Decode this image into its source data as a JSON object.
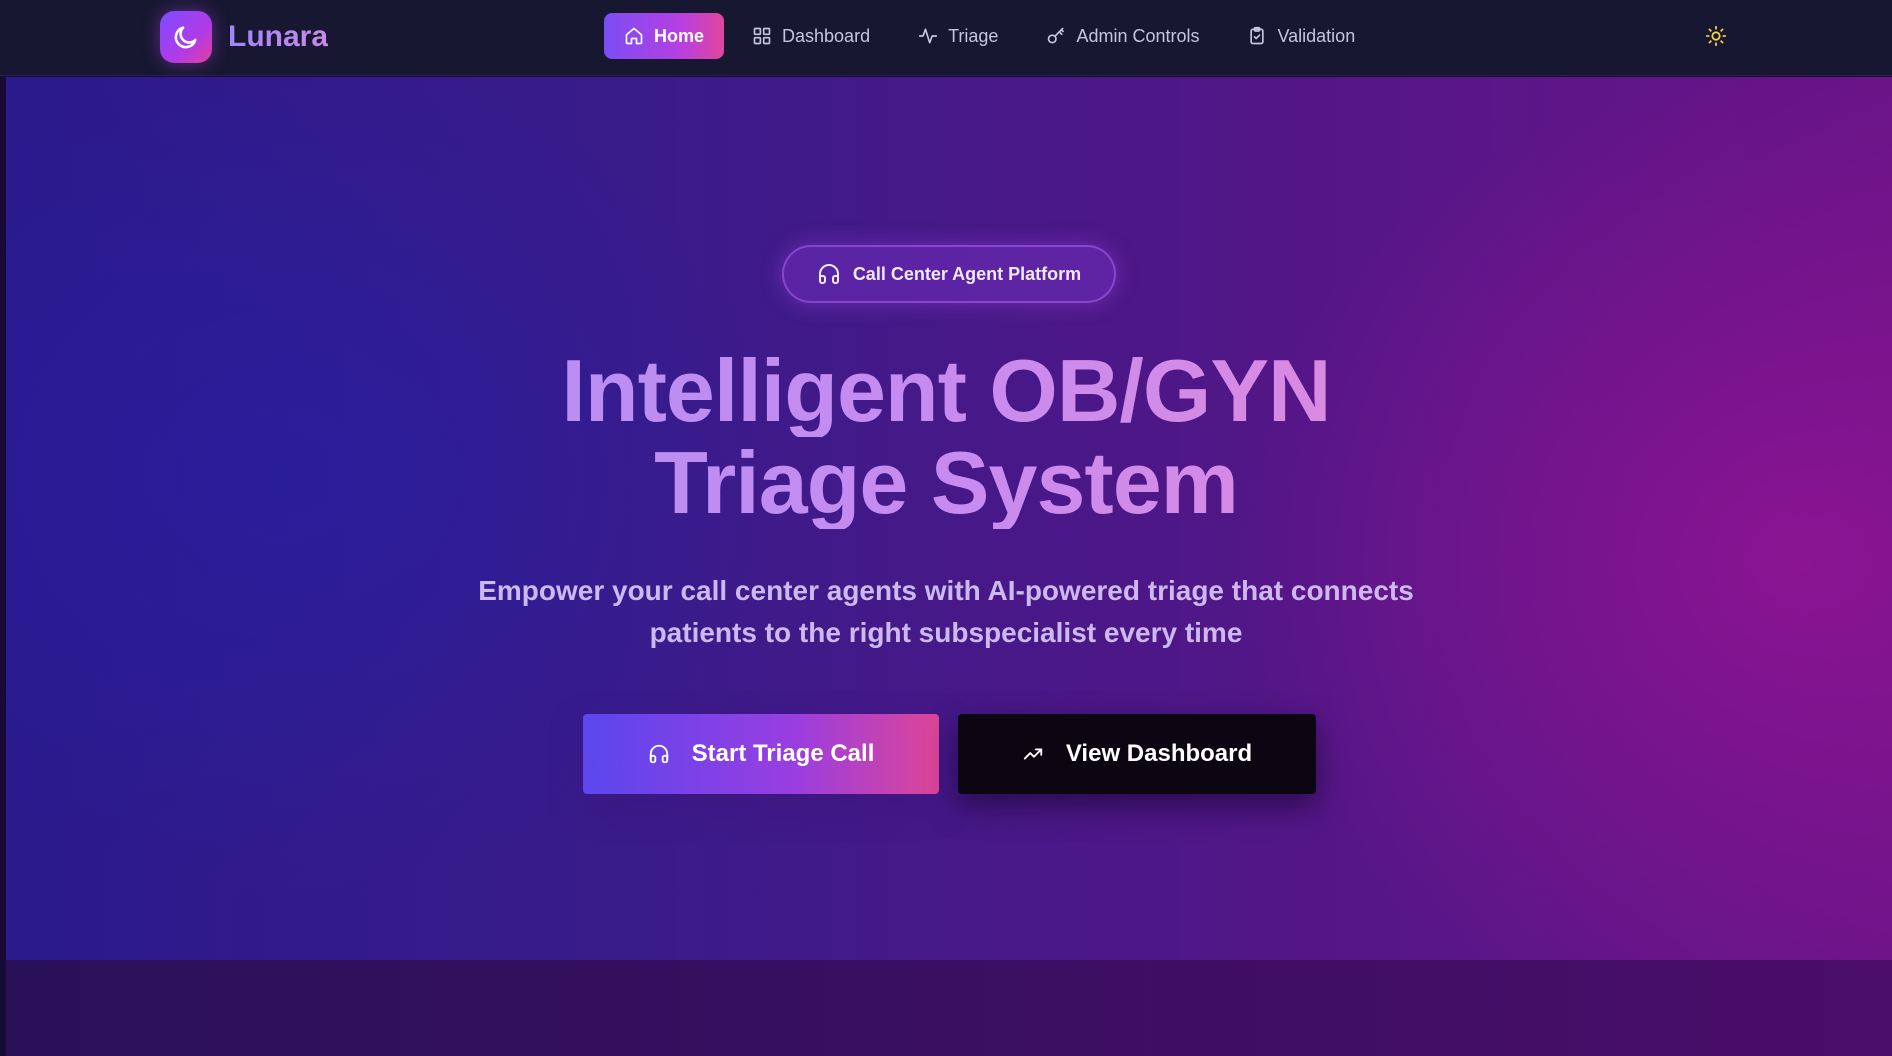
{
  "brand": {
    "name": "Lunara",
    "logo_icon": "moon-icon"
  },
  "nav": {
    "items": [
      {
        "label": "Home",
        "icon": "home-icon",
        "active": true
      },
      {
        "label": "Dashboard",
        "icon": "grid-icon",
        "active": false
      },
      {
        "label": "Triage",
        "icon": "activity-icon",
        "active": false
      },
      {
        "label": "Admin Controls",
        "icon": "key-icon",
        "active": false
      },
      {
        "label": "Validation",
        "icon": "clipboard-check-icon",
        "active": false
      }
    ],
    "theme_toggle_icon": "sun-icon"
  },
  "hero": {
    "badge": "Call Center Agent Platform",
    "headline_line1": "Intelligent OB/GYN",
    "headline_line2": "Triage System",
    "subtitle_line1": "Empower your call center agents with AI-powered triage that connects",
    "subtitle_line2": "patients to the right subspecialist every time",
    "primary_button": "Start Triage Call",
    "secondary_button": "View Dashboard"
  },
  "colors": {
    "nav_bg": "#171731",
    "accent_start": "#7a4df5",
    "accent_end": "#e0479a",
    "theme_icon": "#f2d24a"
  }
}
